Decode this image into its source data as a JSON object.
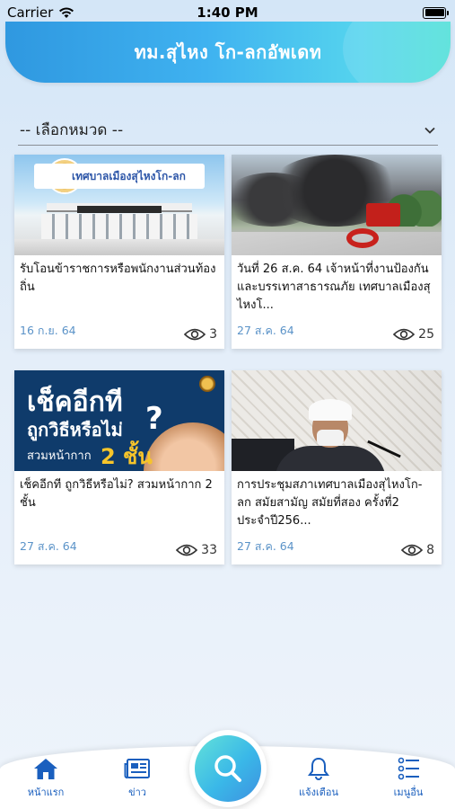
{
  "status_bar": {
    "carrier": "Carrier",
    "time": "1:40 PM"
  },
  "header": {
    "title": "ทม.สุไหง โก-ลกอัพเดท"
  },
  "category_filter": {
    "selected": "-- เลือกหมวด --"
  },
  "news": [
    {
      "title": "รับโอนข้าราชการหรือพนักงานส่วนท้องถิ่น",
      "date": "16 ก.ย. 64",
      "views": "3",
      "image": "municipal-building",
      "image_text": {
        "banner": "เทศบาลเมืองสุไหงโก-ลก"
      }
    },
    {
      "title": "วันที่ 26 ส.ค. 64 เจ้าหน้าที่งานป้องกันและบรรเทาสาธารณภัย เทศบาลเมืองสุไหงโ...",
      "date": "27 ส.ค. 64",
      "views": "25",
      "image": "fire-smoke"
    },
    {
      "title": "เช็คอีกที ถูกวิธีหรือไม่? สวมหน้ากาก 2 ชั้น",
      "date": "27 ส.ค. 64",
      "views": "33",
      "image": "mask-campaign",
      "image_text": {
        "line1": "เช็คอีกที",
        "q": "?",
        "line2": "ถูกวิธีหรือไม่",
        "line3": "สวมหน้ากาก",
        "big": "2 ชั้น"
      }
    },
    {
      "title": "การประชุมสภาเทศบาลเมืองสุไหงโก-ลก สมัยสามัญ สมัยที่สอง ครั้งที่2 ประจำปี256...",
      "date": "27 ส.ค. 64",
      "views": "8",
      "image": "council-meeting"
    }
  ],
  "bottom_nav": {
    "home": "หน้าแรก",
    "news": "ข่าว",
    "notify": "แจ้งเตือน",
    "more": "เมนูอื่น"
  },
  "colors": {
    "accent": "#1a5fbe",
    "date": "#5b93c8",
    "header_start": "#2f98e0",
    "header_end": "#4ee0d8"
  }
}
